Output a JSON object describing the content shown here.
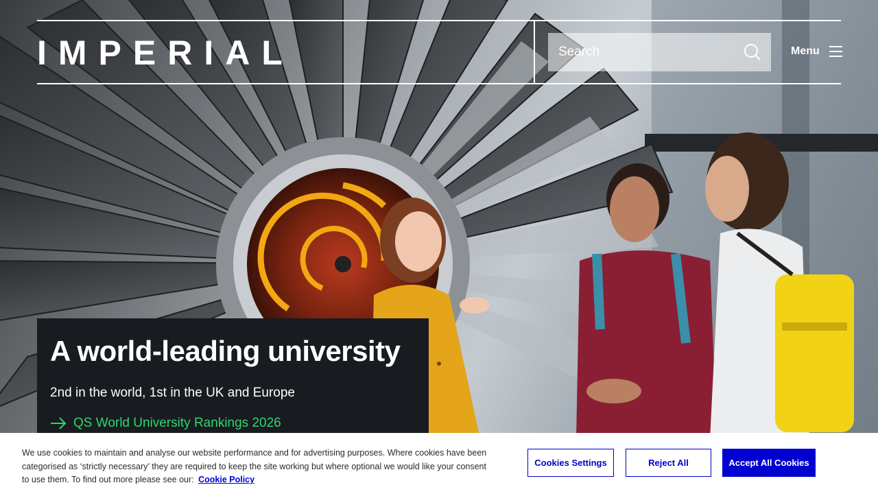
{
  "header": {
    "logo_text": "IMPERIAL",
    "search": {
      "label": "Search",
      "icon": "search-icon"
    },
    "menu": {
      "label": "Menu",
      "icon": "hamburger-icon"
    }
  },
  "hero": {
    "title": "A world-leading university",
    "subtitle": "2nd in the world, 1st in the UK and Europe",
    "link_label": "QS World University Rankings 2026",
    "link_icon": "arrow-right-icon",
    "link_color": "#2fd671",
    "panel_color": "#181b1f"
  },
  "cookie_banner": {
    "text": "We use cookies to maintain and analyse our website performance and for advertising purposes. Where cookies have been categorised as ‘strictly necessary’ they are required to keep the site working but where optional we would like your consent to use them. To find out more please see our:",
    "policy_link": "Cookie Policy",
    "buttons": {
      "settings": "Cookies Settings",
      "reject": "Reject All",
      "accept": "Accept All Cookies"
    },
    "accent_color": "#0000d0"
  }
}
